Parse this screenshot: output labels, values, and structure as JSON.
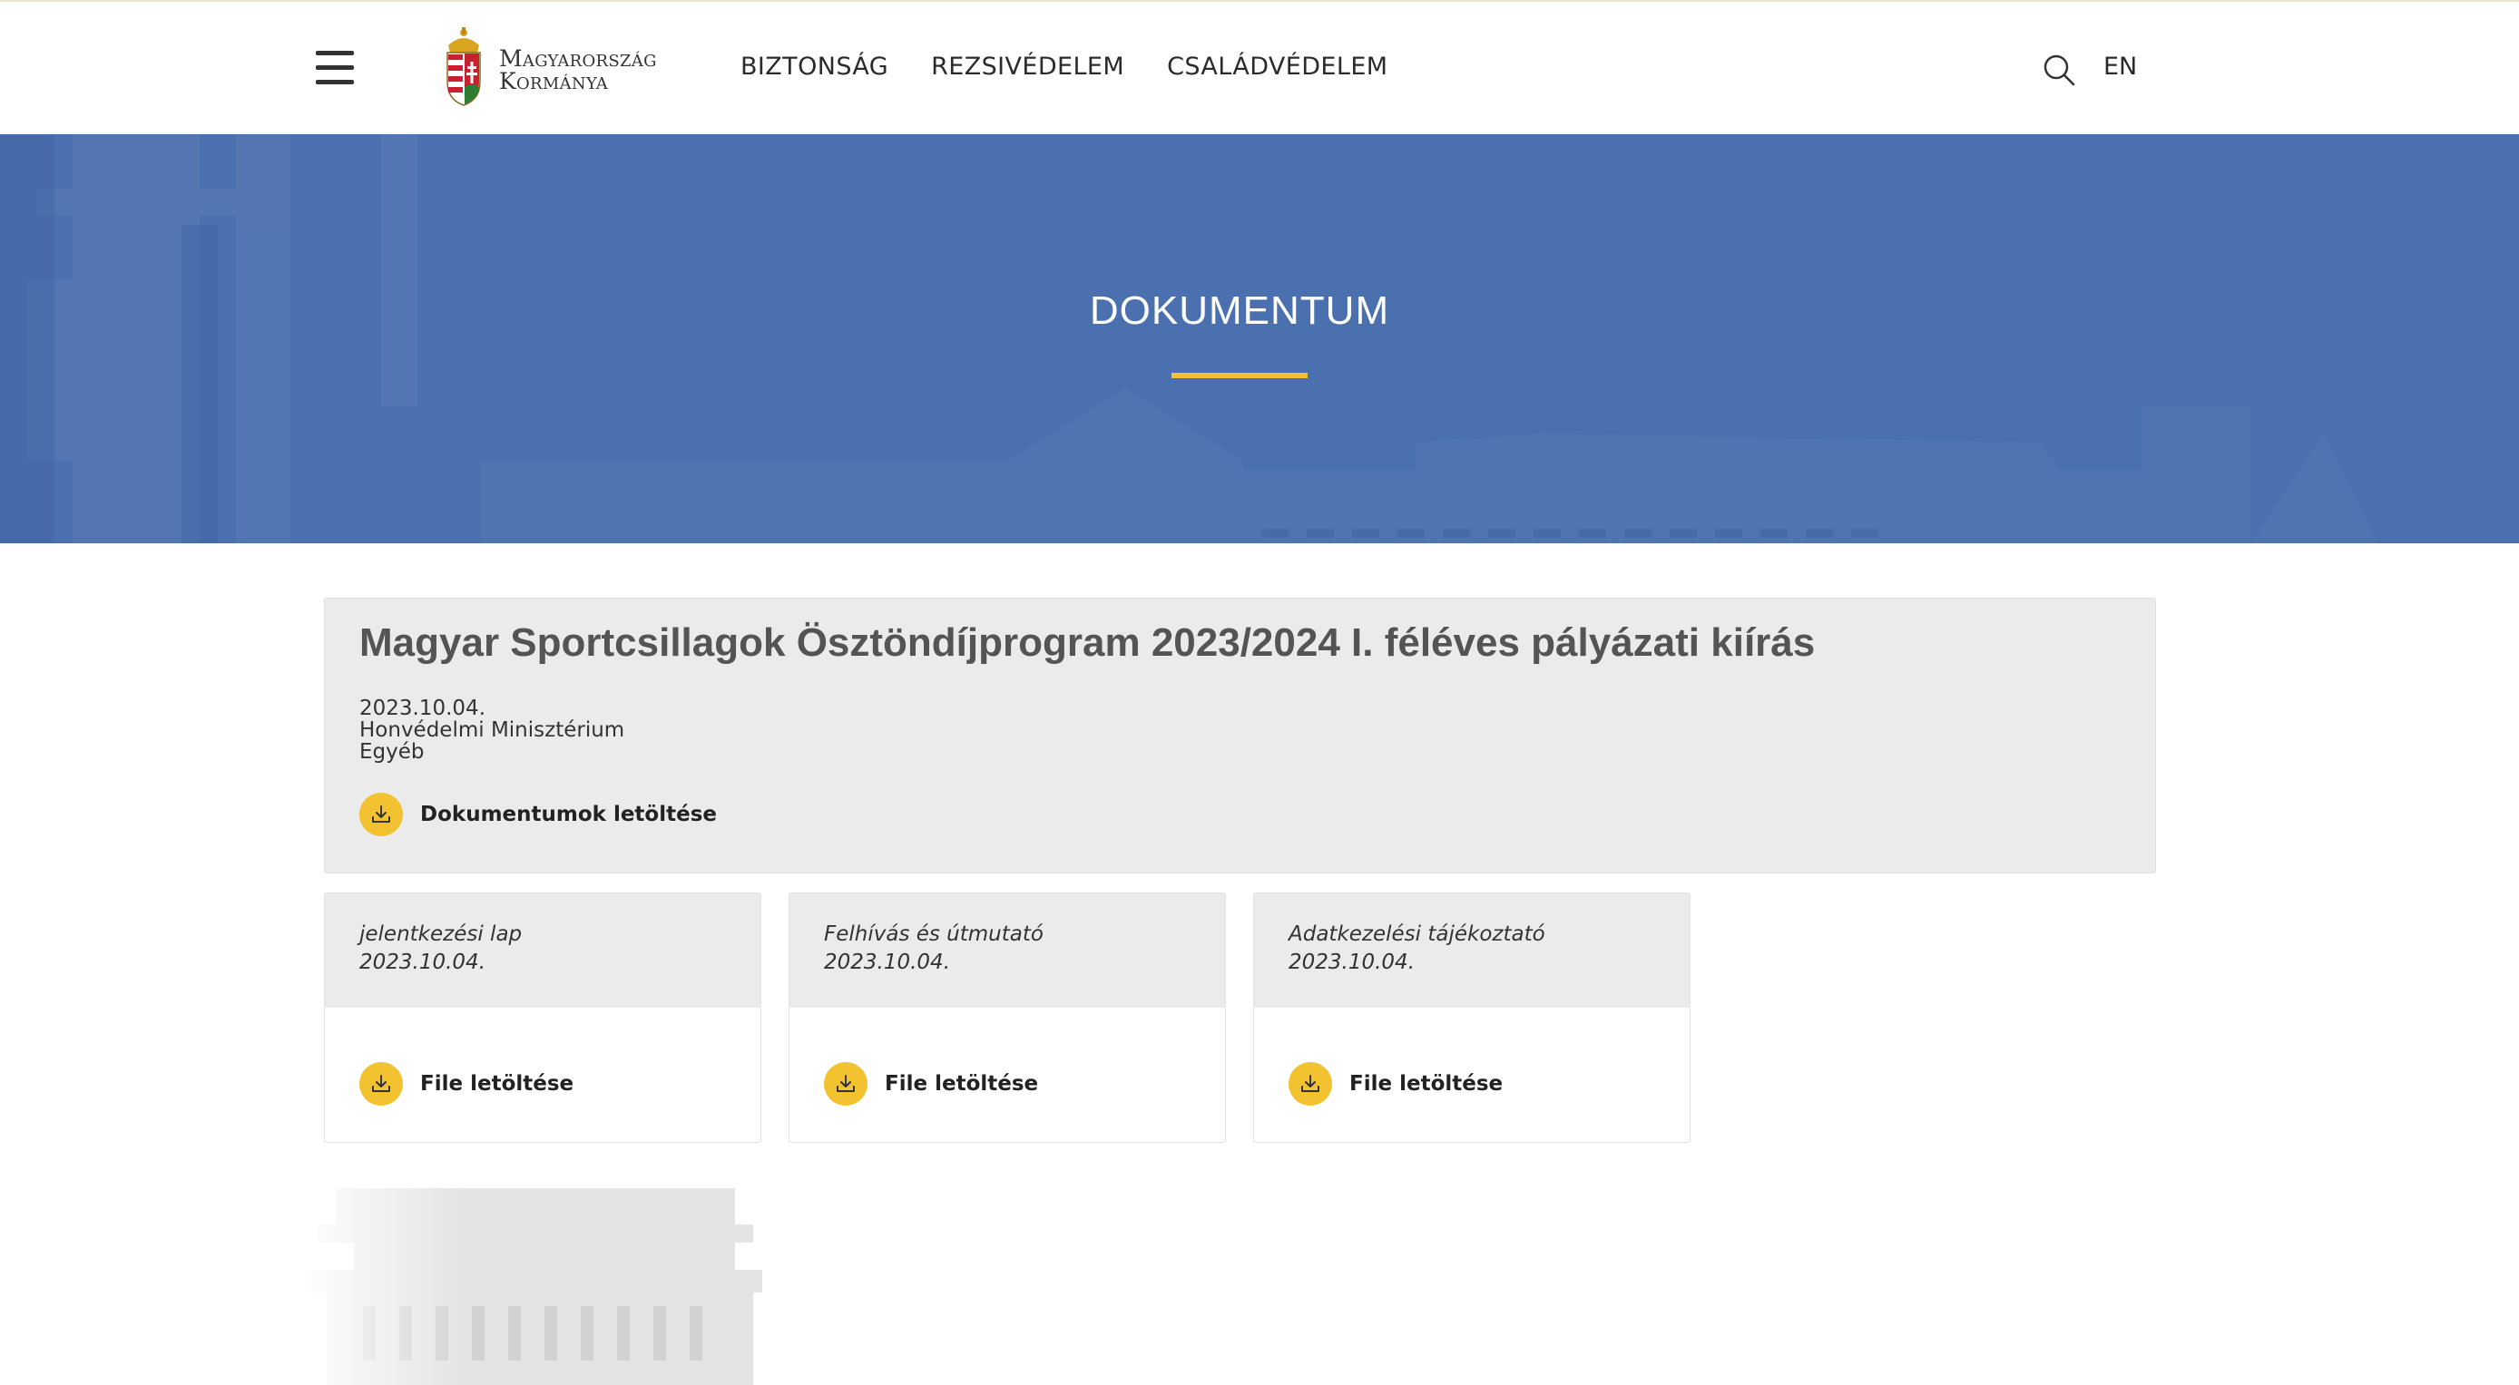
{
  "header": {
    "logo_line1": "Magyarország",
    "logo_line2": "Kormánya",
    "nav": [
      "BIZTONSÁG",
      "REZSIVÉDELEM",
      "CSALÁDVÉDELEM"
    ],
    "language": "EN",
    "icons": [
      "menu-icon",
      "search-icon",
      "coat-of-arms-icon"
    ]
  },
  "hero": {
    "title": "DOKUMENTUM",
    "background_color": "#4b70af",
    "accent_color": "#f2c230"
  },
  "document": {
    "title": "Magyar Sportcsillagok Ösztöndíjprogram 2023/2024 I. féléves pályázati kiírás",
    "date": "2023.10.04.",
    "ministry": "Honvédelmi Minisztérium",
    "category": "Egyéb",
    "download_all_label": "Dokumentumok letöltése"
  },
  "files": [
    {
      "name": "jelentkezési lap",
      "date": "2023.10.04.",
      "download_label": "File letöltése"
    },
    {
      "name": "Felhívás és útmutató",
      "date": "2023.10.04.",
      "download_label": "File letöltése"
    },
    {
      "name": "Adatkezelési tájékoztató",
      "date": "2023.10.04.",
      "download_label": "File letöltése"
    }
  ]
}
